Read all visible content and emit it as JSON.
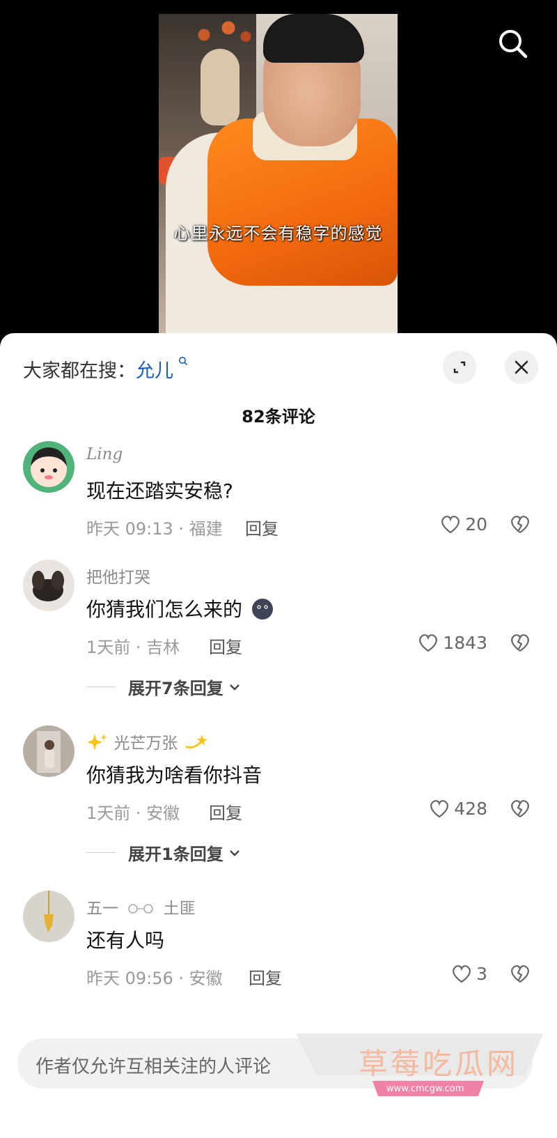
{
  "video": {
    "subtitle": "心里永远不会有稳字的感觉"
  },
  "hot_search": {
    "prefix": "大家都在搜：",
    "term": "允儿"
  },
  "comment_count": "82条评论",
  "comments": [
    {
      "user": "Ling",
      "text": "现在还踏实安稳?",
      "meta": "昨天 09:13 · 福建",
      "reply": "回复",
      "likes": "20"
    },
    {
      "user": "把他打哭",
      "text": "你猜我们怎么来的",
      "meta": "1天前 · 吉林",
      "reply": "回复",
      "likes": "1843",
      "expand": "展开7条回复"
    },
    {
      "user": "光芒万张",
      "text": "你猜我为啥看你抖音",
      "meta": "1天前 · 安徽",
      "reply": "回复",
      "likes": "428",
      "expand": "展开1条回复"
    },
    {
      "user": "五一",
      "user_suffix": "土匪",
      "text": "还有人吗",
      "meta": "昨天 09:56 · 安徽",
      "reply": "回复",
      "likes": "3"
    }
  ],
  "input": {
    "placeholder": "作者仅允许互相关注的人评论"
  },
  "watermark": {
    "title": "草莓吃瓜网",
    "url": "www.cmcgw.com"
  }
}
